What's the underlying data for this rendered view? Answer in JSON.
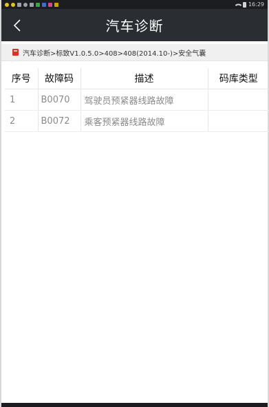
{
  "status_bar": {
    "time": "16:29",
    "left_icons": [
      "yellow-dot-icon",
      "yellow-dot-icon",
      "notification-icon",
      "notification-icon",
      "notification-icon",
      "green-app-icon",
      "blue-app-icon",
      "pink-app-icon",
      "alert-icon"
    ]
  },
  "header": {
    "title": "汽车诊断",
    "back_icon": "chevron-left-icon"
  },
  "breadcrumb": {
    "text": "汽车诊断>标致V1.0.5.0>408>408(2014.10-)>安全气囊",
    "icon": "module-icon"
  },
  "table": {
    "columns": [
      "序号",
      "故障码",
      "描述",
      "码库类型"
    ],
    "rows": [
      {
        "index": "1",
        "code": "B0070",
        "description": "驾驶员预紧器线路故障",
        "type": ""
      },
      {
        "index": "2",
        "code": "B0072",
        "description": "乘客预紧器线路故障",
        "type": ""
      }
    ]
  },
  "colors": {
    "status_bar_bg": "#1b1d20",
    "title_bar_bg": "#2a2e32",
    "breadcrumb_bg": "#f0f0f0",
    "accent_red": "#d9342b"
  }
}
